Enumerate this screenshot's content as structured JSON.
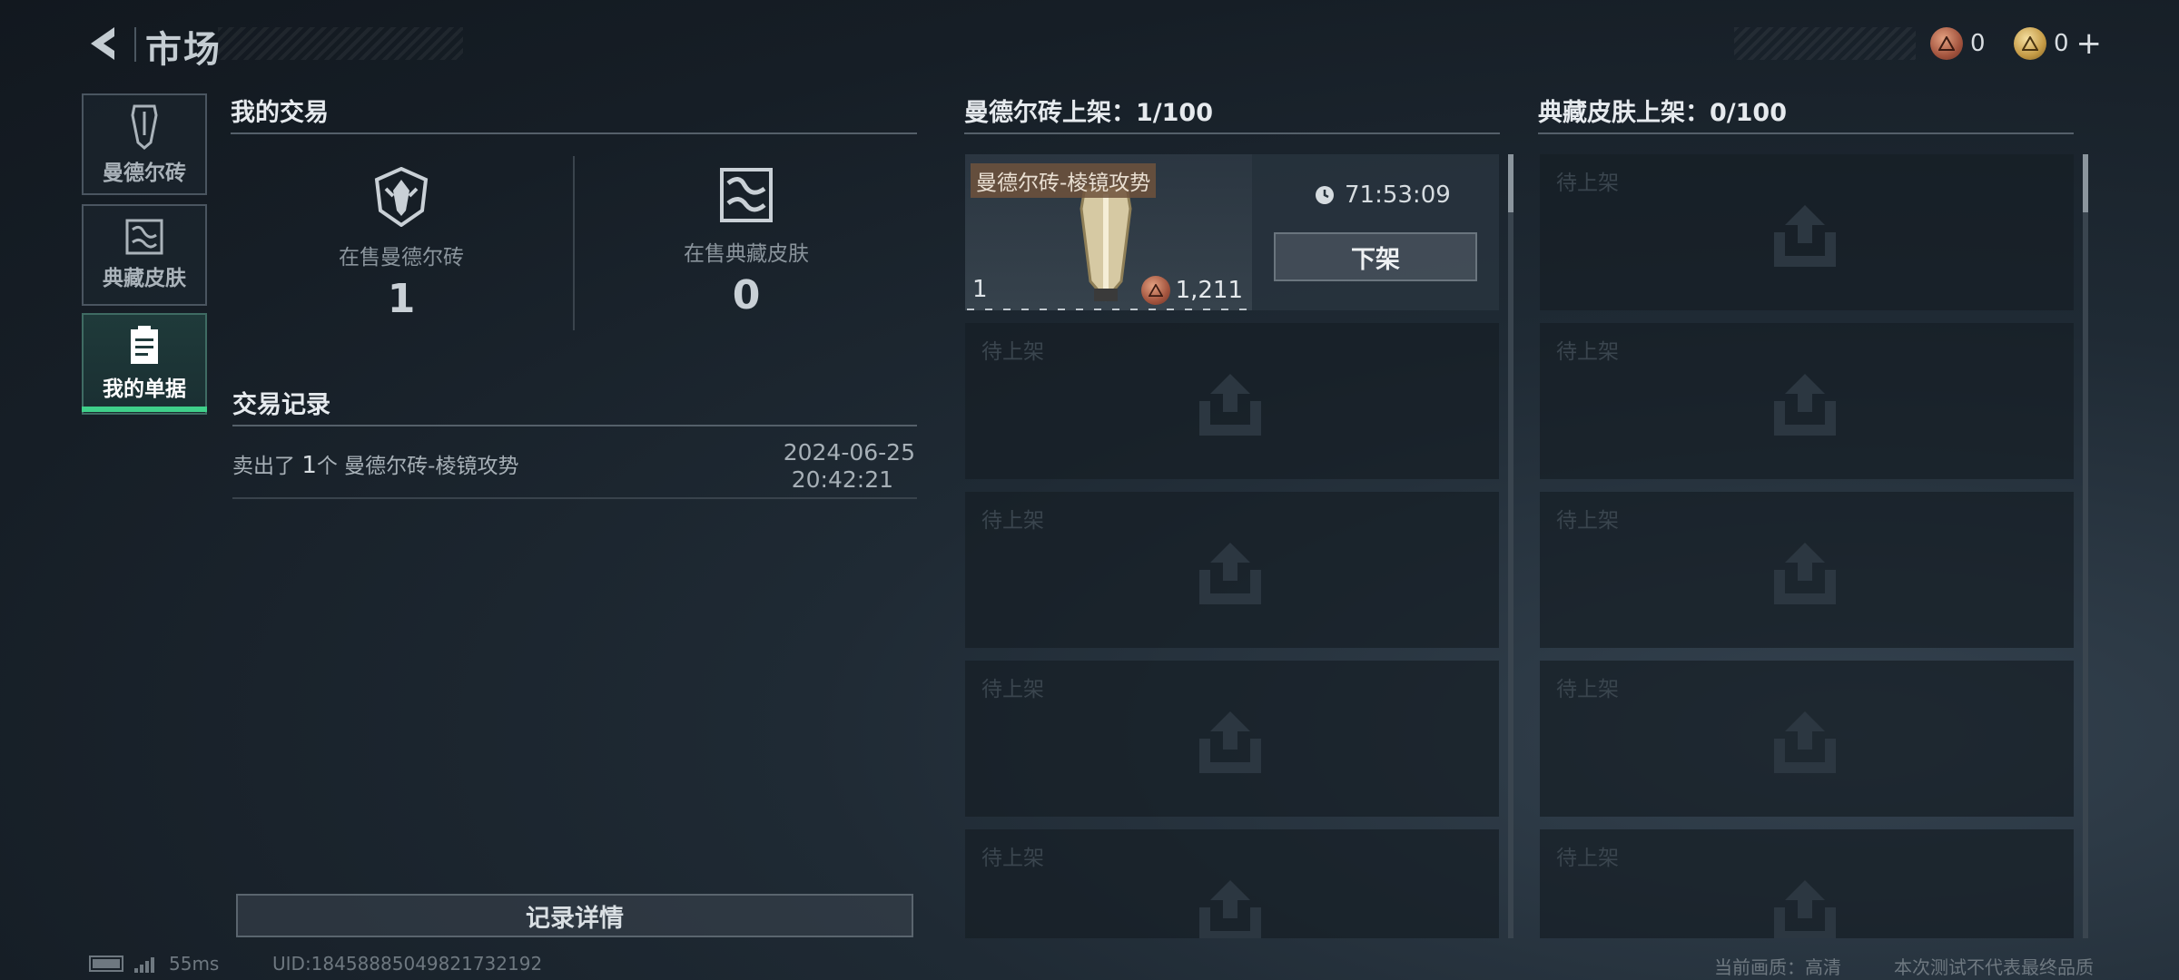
{
  "header": {
    "title": "市场",
    "currency_bronze": "0",
    "currency_gold": "0",
    "add_label": "+"
  },
  "nav": {
    "items": [
      {
        "label": "曼德尔砖",
        "icon": "mandel-brick-icon"
      },
      {
        "label": "典藏皮肤",
        "icon": "collection-skin-icon"
      },
      {
        "label": "我的单据",
        "icon": "document-icon",
        "active": true
      }
    ]
  },
  "my_trades": {
    "title": "我的交易",
    "stats": [
      {
        "label": "在售曼德尔砖",
        "value": "1"
      },
      {
        "label": "在售典藏皮肤",
        "value": "0"
      }
    ]
  },
  "records": {
    "title": "交易记录",
    "items": [
      {
        "prefix": "卖出了 ",
        "qty": "1",
        "suffix": "个 曼德尔砖-棱镜攻势",
        "date": "2024-06-25",
        "time": "20:42:21"
      }
    ],
    "detail_button": "记录详情"
  },
  "brick_listings": {
    "title": "曼德尔砖上架：1/100",
    "listed": {
      "name": "曼德尔砖-棱镜攻势",
      "qty": "1",
      "price": "1,211",
      "timer": "71:53:09",
      "unlist_button": "下架"
    },
    "empty_label": "待上架"
  },
  "skin_listings": {
    "title": "典藏皮肤上架：0/100",
    "empty_label": "待上架"
  },
  "footer": {
    "ping": "55ms",
    "uid": "UID:18458885049821732192",
    "quality": "当前画质：高清",
    "disclaimer": "本次测试不代表最终品质"
  },
  "colors": {
    "active_accent": "#3fd08a",
    "background": "#1a232c"
  }
}
